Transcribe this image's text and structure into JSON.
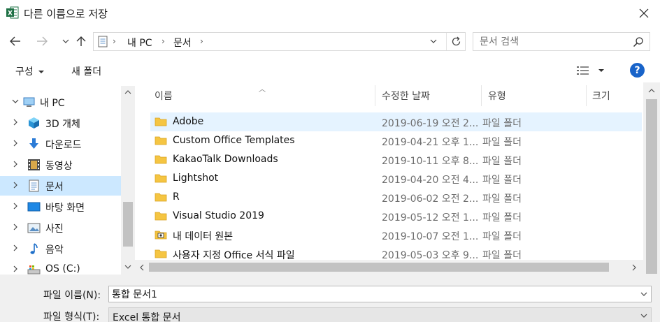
{
  "window": {
    "title": "다른 이름으로 저장",
    "app_icon": "excel-icon",
    "close_icon": "close-icon"
  },
  "toolbar": {
    "back_icon": "arrow-left-icon",
    "forward_icon": "arrow-right-icon",
    "recent_icon": "chevron-down-icon",
    "up_icon": "arrow-up-icon",
    "address": {
      "crumbs": [
        "내 PC",
        "문서"
      ],
      "refresh_icon": "refresh-icon"
    },
    "search": {
      "placeholder": "문서 검색",
      "icon": "search-icon"
    }
  },
  "commands": {
    "organize_label": "구성",
    "new_folder_label": "새 폴더",
    "view_icon": "view-options-icon",
    "help_label": "?"
  },
  "nav": {
    "items": [
      {
        "label": "내 PC",
        "icon": "computer-icon",
        "expanded": true,
        "selected": false
      },
      {
        "label": "3D 개체",
        "icon": "cube-icon",
        "expanded": false,
        "selected": false
      },
      {
        "label": "다운로드",
        "icon": "download-icon",
        "expanded": false,
        "selected": false
      },
      {
        "label": "동영상",
        "icon": "video-icon",
        "expanded": false,
        "selected": false
      },
      {
        "label": "문서",
        "icon": "document-icon",
        "expanded": false,
        "selected": true
      },
      {
        "label": "바탕 화면",
        "icon": "desktop-icon",
        "expanded": false,
        "selected": false
      },
      {
        "label": "사진",
        "icon": "picture-icon",
        "expanded": false,
        "selected": false
      },
      {
        "label": "음악",
        "icon": "music-icon",
        "expanded": false,
        "selected": false
      },
      {
        "label": "OS (C:)",
        "icon": "drive-icon",
        "expanded": false,
        "selected": false
      }
    ]
  },
  "files": {
    "columns": [
      "이름",
      "수정한 날짜",
      "유형",
      "크기"
    ],
    "rows": [
      {
        "name": "Adobe",
        "date": "2019-06-19 오전 2...",
        "type": "파일 폴더",
        "icon": "folder-icon",
        "selected": true
      },
      {
        "name": "Custom Office Templates",
        "date": "2019-04-21 오후 1...",
        "type": "파일 폴더",
        "icon": "folder-icon",
        "selected": false
      },
      {
        "name": "KakaoTalk Downloads",
        "date": "2019-10-11 오후 8...",
        "type": "파일 폴더",
        "icon": "folder-icon",
        "selected": false
      },
      {
        "name": "Lightshot",
        "date": "2019-04-20 오전 4...",
        "type": "파일 폴더",
        "icon": "folder-icon",
        "selected": false
      },
      {
        "name": "R",
        "date": "2019-06-02 오전 2...",
        "type": "파일 폴더",
        "icon": "folder-icon",
        "selected": false
      },
      {
        "name": "Visual Studio 2019",
        "date": "2019-05-12 오전 1...",
        "type": "파일 폴더",
        "icon": "folder-icon",
        "selected": false
      },
      {
        "name": "내 데이터 원본",
        "date": "2019-10-07 오전 1...",
        "type": "파일 폴더",
        "icon": "data-source-folder-icon",
        "selected": false
      },
      {
        "name": "사용자 지정 Office 서식 파일",
        "date": "2019-05-03 오후 9...",
        "type": "파일 폴더",
        "icon": "folder-icon",
        "selected": false
      }
    ]
  },
  "save": {
    "filename_label": "파일 이름(N):",
    "filename_value": "통합 문서1",
    "filetype_label": "파일 형식(T):",
    "filetype_value": "Excel 통합 문서"
  },
  "colors": {
    "selection": "#cce8ff",
    "hover_row": "#e5f3ff",
    "help_blue": "#1863c9",
    "excel_green": "#1d7044",
    "folder_yellow": "#f5c542"
  }
}
